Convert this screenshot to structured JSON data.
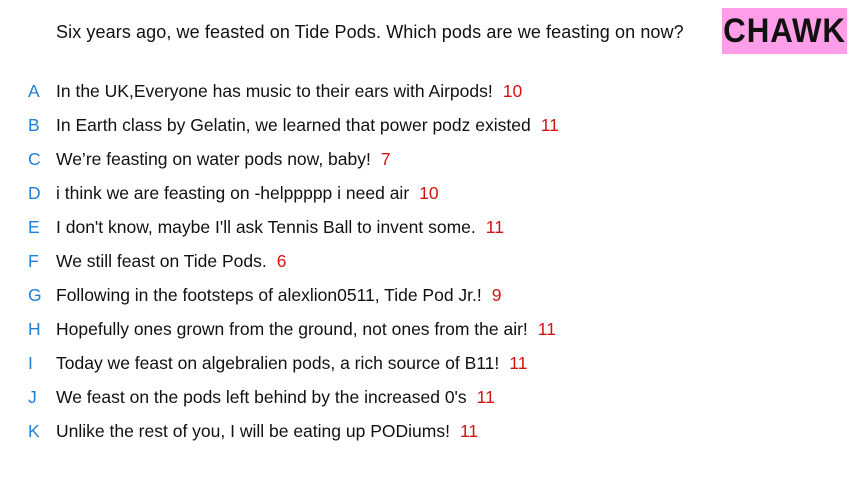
{
  "colors": {
    "background": "#ffffff",
    "text": "#111111",
    "letter": "#1e7fd6",
    "score": "#d41414",
    "badge_bg": "#ff9ee8"
  },
  "question": "Six years ago, we feasted on Tide Pods. Which pods are we feasting on now?",
  "badge": "CHAWK",
  "answers": [
    {
      "letter": "A",
      "text": "In the UK,Everyone has music to their ears with Airpods!",
      "score": "10"
    },
    {
      "letter": "B",
      "text": "In Earth class by Gelatin, we learned that power podz existed",
      "score": "11"
    },
    {
      "letter": "C",
      "text": "We’re feasting on water pods now, baby!",
      "score": "7"
    },
    {
      "letter": "D",
      "text": "i think we are feasting on -helppppp i need air",
      "score": "10"
    },
    {
      "letter": "E",
      "text": "I don't know, maybe I'll ask Tennis Ball to invent some.",
      "score": "11"
    },
    {
      "letter": "F",
      "text": "We still feast on Tide Pods.",
      "score": "6"
    },
    {
      "letter": "G",
      "text": "Following in the footsteps of alexlion0511, Tide Pod Jr.!",
      "score": "9"
    },
    {
      "letter": "H",
      "text": "Hopefully ones grown from the ground, not ones from the air!",
      "score": "11"
    },
    {
      "letter": "I",
      "text": "Today we feast on algebralien pods, a rich source of B11!",
      "score": "11"
    },
    {
      "letter": "J",
      "text": "We feast on the pods left behind by the increased 0's",
      "score": "11"
    },
    {
      "letter": "K",
      "text": "Unlike the rest of you, I will be eating up PODiums!",
      "score": "11"
    }
  ]
}
